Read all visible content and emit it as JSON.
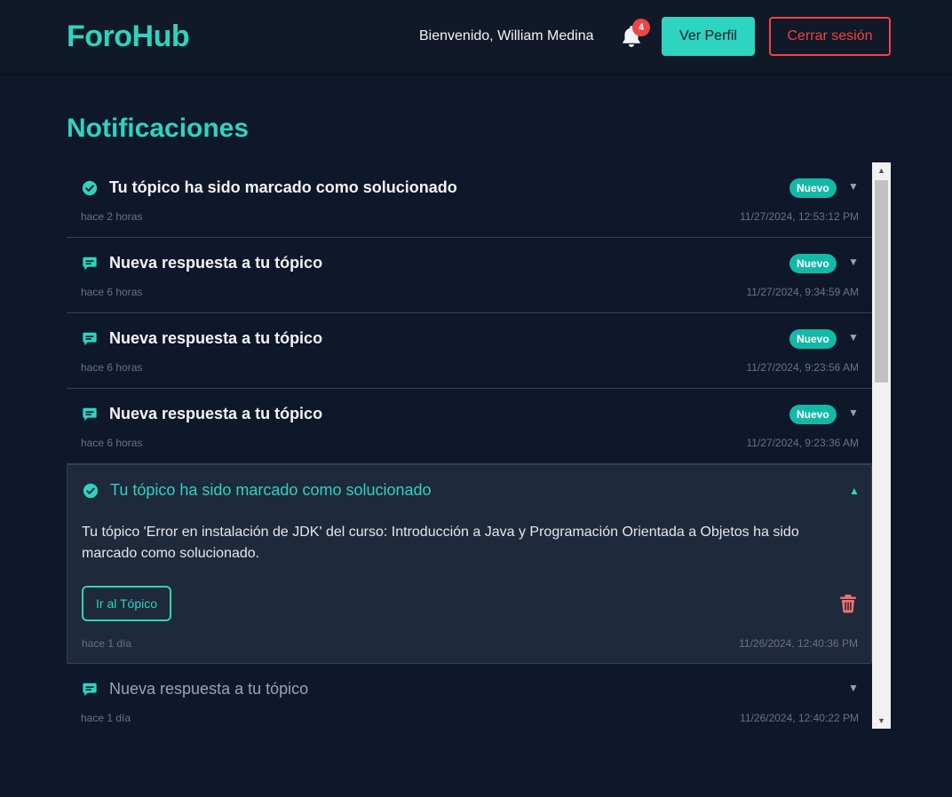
{
  "header": {
    "brand": "ForoHub",
    "welcome": "Bienvenido, William Medina",
    "notification_count": "4",
    "profile_button": "Ver Perfil",
    "logout_button": "Cerrar sesión"
  },
  "page": {
    "title": "Notificaciones"
  },
  "notifications": [
    {
      "icon": "check-circle-icon",
      "title": "Tu tópico ha sido marcado como solucionado",
      "badge": "Nuevo",
      "ago": "hace 2 horas",
      "date": "11/27/2024, 12:53:12 PM"
    },
    {
      "icon": "chat-bubble-icon",
      "title": "Nueva respuesta a tu tópico",
      "badge": "Nuevo",
      "ago": "hace 6 horas",
      "date": "11/27/2024, 9:34:59 AM"
    },
    {
      "icon": "chat-bubble-icon",
      "title": "Nueva respuesta a tu tópico",
      "badge": "Nuevo",
      "ago": "hace 6 horas",
      "date": "11/27/2024, 9:23:56 AM"
    },
    {
      "icon": "chat-bubble-icon",
      "title": "Nueva respuesta a tu tópico",
      "badge": "Nuevo",
      "ago": "hace 6 horas",
      "date": "11/27/2024, 9:23:36 AM"
    },
    {
      "icon": "check-circle-icon",
      "title": "Tu tópico ha sido marcado como solucionado",
      "ago": "hace 1 día",
      "date": "11/26/2024, 12:40:36 PM",
      "expanded": true,
      "body": "Tu tópico 'Error en instalación de JDK' del curso: Introducción a Java y Programación Orientada a Objetos ha sido marcado como solucionado.",
      "action_button": "Ir al Tópico"
    },
    {
      "icon": "chat-bubble-icon",
      "title": "Nueva respuesta a tu tópico",
      "ago": "hace 1 día",
      "date": "11/26/2024, 12:40:22 PM"
    }
  ],
  "colors": {
    "accent": "#2dd4bf",
    "danger": "#ef4444",
    "background": "#0f172a",
    "badge": "#14b8a6"
  }
}
